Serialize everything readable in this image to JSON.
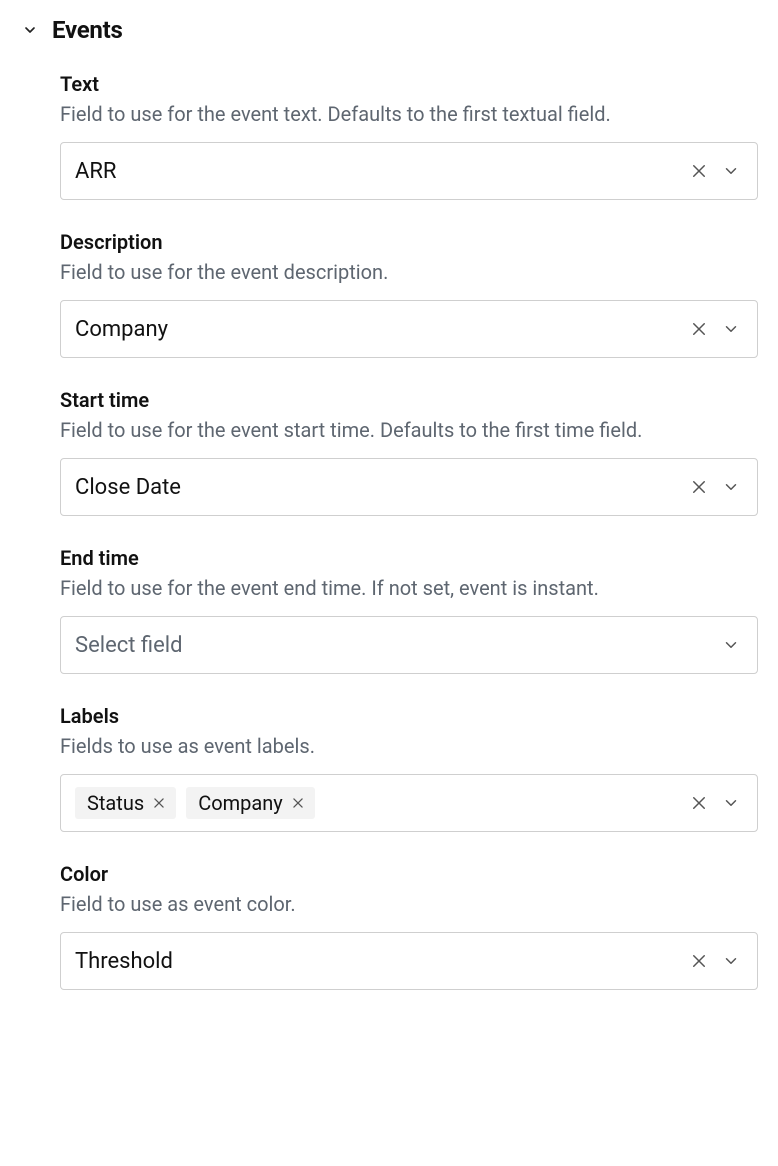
{
  "section": {
    "title": "Events"
  },
  "fields": {
    "text": {
      "label": "Text",
      "description": "Field to use for the event text. Defaults to the first textual field.",
      "value": "ARR"
    },
    "description": {
      "label": "Description",
      "description": "Field to use for the event description.",
      "value": "Company"
    },
    "start_time": {
      "label": "Start time",
      "description": "Field to use for the event start time. Defaults to the first time field.",
      "value": "Close Date"
    },
    "end_time": {
      "label": "End time",
      "description": "Field to use for the event end time. If not set, event is instant.",
      "placeholder": "Select field"
    },
    "labels": {
      "label": "Labels",
      "description": "Fields to use as event labels.",
      "chips": {
        "0": "Status",
        "1": "Company"
      }
    },
    "color": {
      "label": "Color",
      "description": "Field to use as event color.",
      "value": "Threshold"
    }
  }
}
